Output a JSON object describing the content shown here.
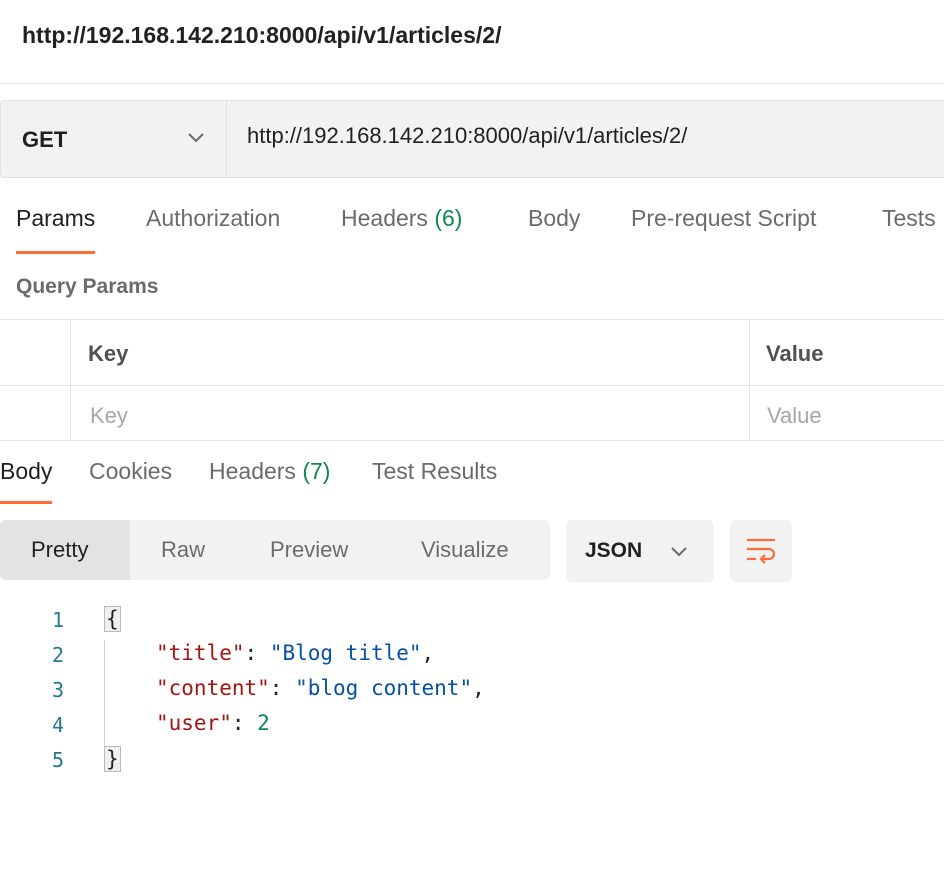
{
  "title": "http://192.168.142.210:8000/api/v1/articles/2/",
  "request": {
    "method": "GET",
    "url": "http://192.168.142.210:8000/api/v1/articles/2/"
  },
  "request_tabs": [
    {
      "label": "Params",
      "count": "",
      "active": true
    },
    {
      "label": "Authorization",
      "count": ""
    },
    {
      "label": "Headers",
      "count": "(6)"
    },
    {
      "label": "Body",
      "count": ""
    },
    {
      "label": "Pre-request Script",
      "count": ""
    },
    {
      "label": "Tests",
      "count": ""
    }
  ],
  "query_params": {
    "label": "Query Params",
    "headers": {
      "key": "Key",
      "value": "Value"
    },
    "placeholders": {
      "key": "Key",
      "value": "Value"
    }
  },
  "response_tabs": [
    {
      "label": "Body",
      "count": "",
      "active": true
    },
    {
      "label": "Cookies",
      "count": ""
    },
    {
      "label": "Headers",
      "count": "(7)"
    },
    {
      "label": "Test Results",
      "count": ""
    }
  ],
  "format_buttons": [
    {
      "label": "Pretty",
      "active": true
    },
    {
      "label": "Raw"
    },
    {
      "label": "Preview"
    },
    {
      "label": "Visualize"
    }
  ],
  "language": "JSON",
  "wrap_icon": "wrap-lines-icon",
  "colors": {
    "accent": "#ff6c37",
    "count": "#0e8a4a",
    "json_key": "#a31515",
    "json_string": "#0451a5",
    "json_number": "#098658"
  },
  "response_body": {
    "line_numbers": [
      "1",
      "2",
      "3",
      "4",
      "5"
    ],
    "open_brace": "{",
    "close_brace": "}",
    "fields": [
      {
        "key": "\"title\"",
        "sep": ": ",
        "value": "\"Blog title\"",
        "type": "string",
        "trail": ","
      },
      {
        "key": "\"content\"",
        "sep": ": ",
        "value": "\"blog content\"",
        "type": "string",
        "trail": ","
      },
      {
        "key": "\"user\"",
        "sep": ": ",
        "value": "2",
        "type": "number",
        "trail": ""
      }
    ]
  }
}
